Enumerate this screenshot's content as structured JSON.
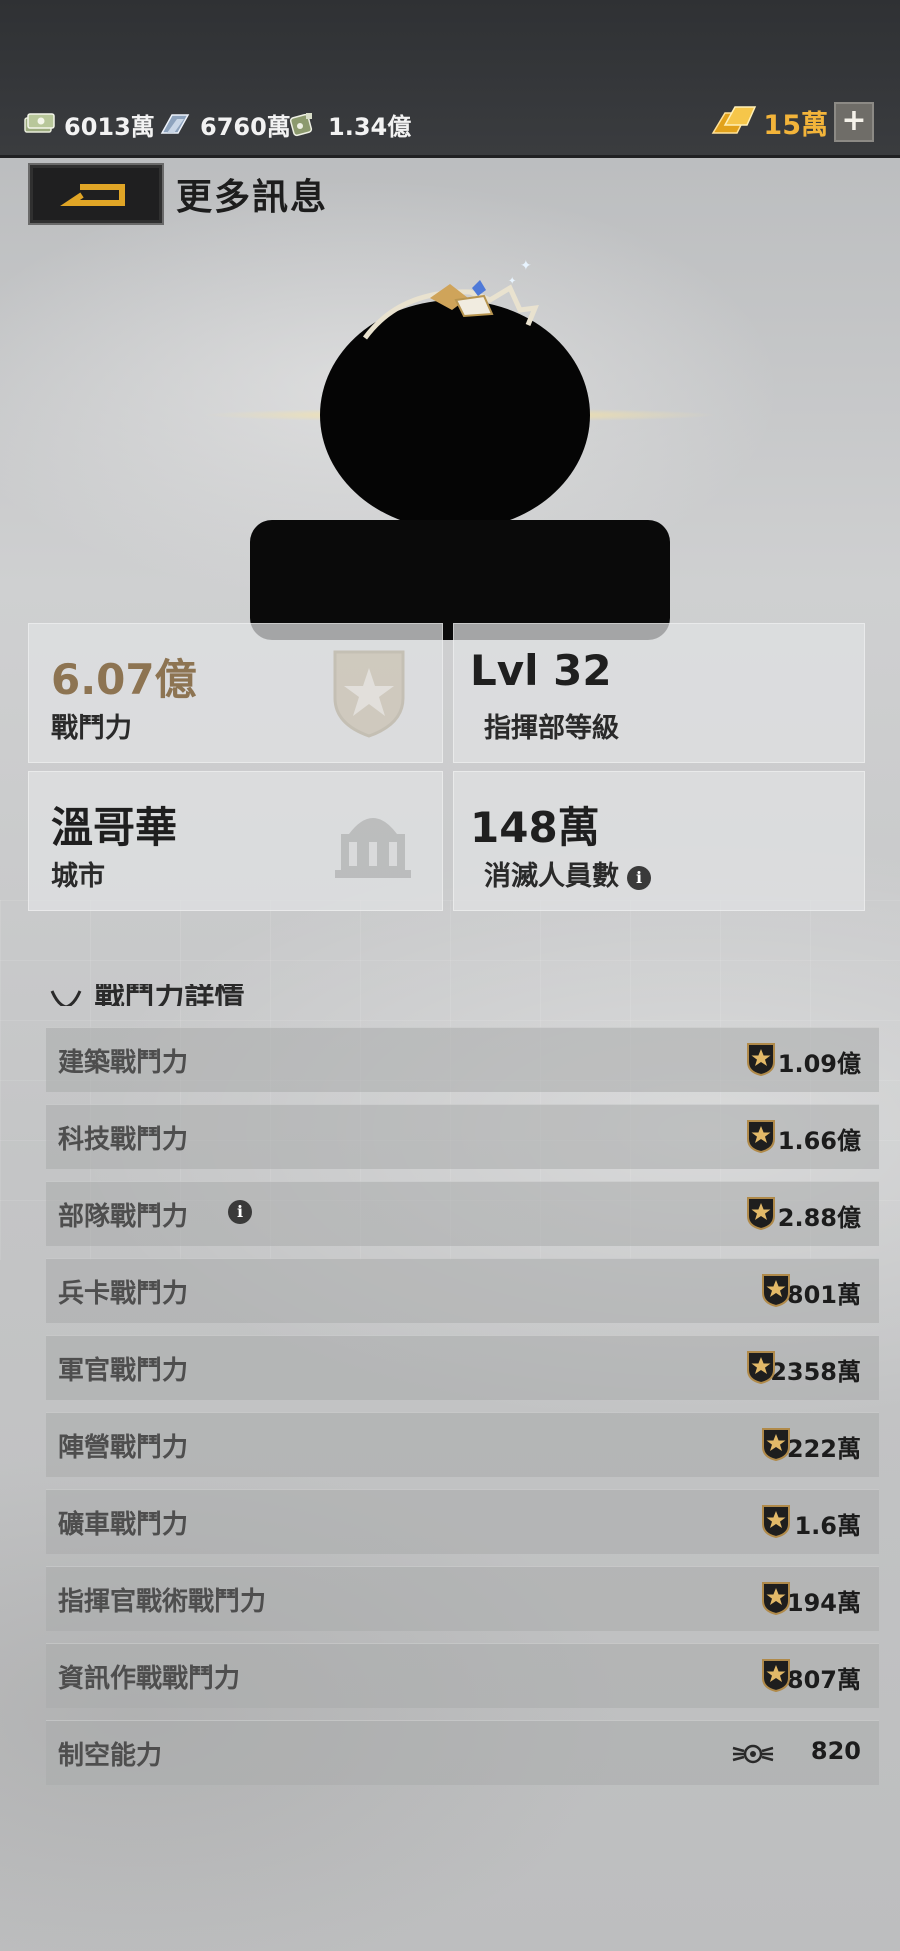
{
  "resources": {
    "cash": "6013萬",
    "steel": "6760萬",
    "oil": "1.34億",
    "gold": "15萬",
    "gold_add": "+"
  },
  "header": {
    "title": "更多訊息"
  },
  "cards": {
    "power": {
      "value": "6.07億",
      "label": "戰鬥力"
    },
    "level": {
      "value": "Lvl 32",
      "label": "指揮部等級"
    },
    "city": {
      "value": "溫哥華",
      "label": "城市"
    },
    "kills": {
      "value": "148萬",
      "label": "消滅人員數"
    }
  },
  "details": {
    "title": "戰鬥力詳情",
    "rows": [
      {
        "label": "建築戰鬥力",
        "value": "1.09億",
        "icon": "star-badge-icon"
      },
      {
        "label": "科技戰鬥力",
        "value": "1.66億",
        "icon": "star-badge-icon"
      },
      {
        "label": "部隊戰鬥力",
        "value": "2.88億",
        "icon": "star-badge-icon",
        "info": true
      },
      {
        "label": "兵卡戰鬥力",
        "value": "801萬",
        "icon": "star-badge-icon"
      },
      {
        "label": "軍官戰鬥力",
        "value": "2358萬",
        "icon": "star-badge-icon"
      },
      {
        "label": "陣營戰鬥力",
        "value": "222萬",
        "icon": "star-badge-icon"
      },
      {
        "label": "礦車戰鬥力",
        "value": "1.6萬",
        "icon": "star-badge-icon"
      },
      {
        "label": "指揮官戰術戰鬥力",
        "value": "194萬",
        "icon": "star-badge-icon"
      },
      {
        "label": "資訊作戰戰鬥力",
        "value": "807萬",
        "icon": "star-badge-icon"
      },
      {
        "label": "制空能力",
        "value": "820",
        "icon": "air-wing-icon"
      }
    ]
  },
  "colors": {
    "gold": "#f3b43a",
    "power_value": "#8d7452",
    "topbar": "#2f3134"
  }
}
